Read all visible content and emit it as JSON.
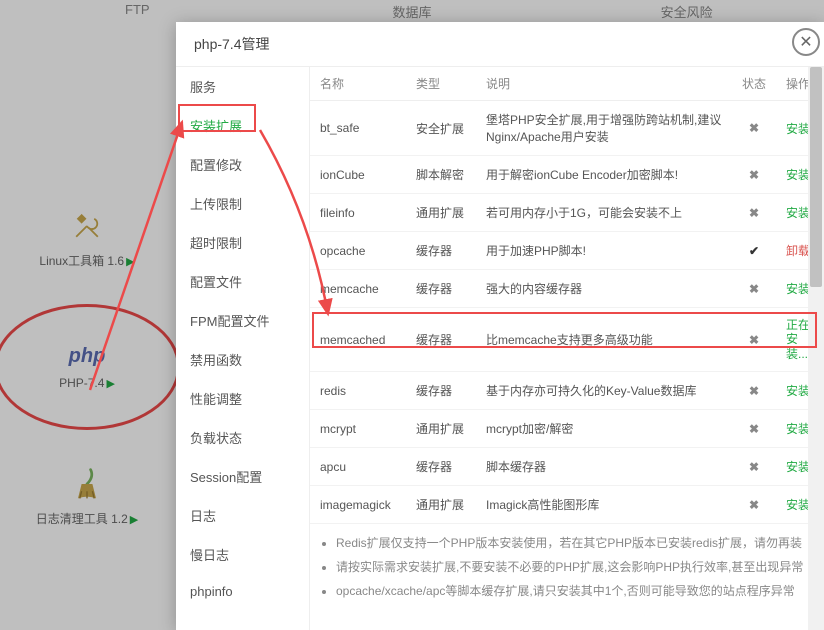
{
  "bg_tabs": {
    "ftp": "FTP",
    "db": "数据库",
    "security": "安全风险"
  },
  "bg_cards": [
    {
      "label": "Linux工具箱 1.6",
      "icon": "tools"
    },
    {
      "label": "PHP-7.4",
      "icon": "php"
    },
    {
      "label": "日志清理工具 1.2",
      "icon": "broom"
    }
  ],
  "modal": {
    "title": "php-7.4管理"
  },
  "sidebar": {
    "items": [
      {
        "label": "服务"
      },
      {
        "label": "安装扩展",
        "active": true
      },
      {
        "label": "配置修改"
      },
      {
        "label": "上传限制"
      },
      {
        "label": "超时限制"
      },
      {
        "label": "配置文件"
      },
      {
        "label": "FPM配置文件"
      },
      {
        "label": "禁用函数"
      },
      {
        "label": "性能调整"
      },
      {
        "label": "负载状态"
      },
      {
        "label": "Session配置"
      },
      {
        "label": "日志"
      },
      {
        "label": "慢日志"
      },
      {
        "label": "phpinfo"
      }
    ]
  },
  "table": {
    "headers": {
      "name": "名称",
      "type": "类型",
      "desc": "说明",
      "status": "状态",
      "action": "操作"
    },
    "action_labels": {
      "install": "安装",
      "uninstall": "卸载",
      "installing": "正在安装..."
    },
    "rows": [
      {
        "name": "bt_safe",
        "type": "安全扩展",
        "desc": "堡塔PHP安全扩展,用于增强防跨站机制,建议Nginx/Apache用户安装",
        "installed": false,
        "action": "install"
      },
      {
        "name": "ionCube",
        "type": "脚本解密",
        "desc": "用于解密ionCube Encoder加密脚本!",
        "installed": false,
        "action": "install"
      },
      {
        "name": "fileinfo",
        "type": "通用扩展",
        "desc": "若可用内存小于1G，可能会安装不上",
        "installed": false,
        "action": "install"
      },
      {
        "name": "opcache",
        "type": "缓存器",
        "desc": "用于加速PHP脚本!",
        "installed": true,
        "action": "uninstall"
      },
      {
        "name": "memcache",
        "type": "缓存器",
        "desc": "强大的内容缓存器",
        "installed": false,
        "action": "install"
      },
      {
        "name": "memcached",
        "type": "缓存器",
        "desc": "比memcache支持更多高级功能",
        "installed": false,
        "action": "installing"
      },
      {
        "name": "redis",
        "type": "缓存器",
        "desc": "基于内存亦可持久化的Key-Value数据库",
        "installed": false,
        "action": "install"
      },
      {
        "name": "mcrypt",
        "type": "通用扩展",
        "desc": "mcrypt加密/解密",
        "installed": false,
        "action": "install"
      },
      {
        "name": "apcu",
        "type": "缓存器",
        "desc": "脚本缓存器",
        "installed": false,
        "action": "install"
      },
      {
        "name": "imagemagick",
        "type": "通用扩展",
        "desc": "Imagick高性能图形库",
        "installed": false,
        "action": "install"
      }
    ]
  },
  "notes": [
    "Redis扩展仅支持一个PHP版本安装使用，若在其它PHP版本已安装redis扩展，请勿再装",
    "请按实际需求安装扩展,不要安装不必要的PHP扩展,这会影响PHP执行效率,甚至出现异常",
    "opcache/xcache/apc等脚本缓存扩展,请只安装其中1个,否则可能导致您的站点程序异常"
  ]
}
